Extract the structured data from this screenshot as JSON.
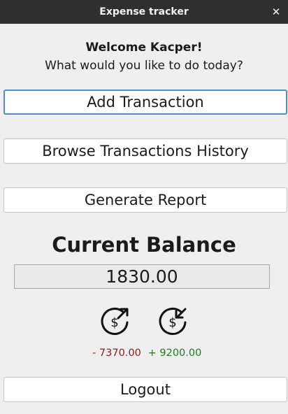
{
  "window": {
    "title": "Expense tracker",
    "close_glyph": "✕"
  },
  "greeting": {
    "welcome": "Welcome Kacper!",
    "prompt": "What would you like to do today?"
  },
  "actions": {
    "add_transaction": "Add Transaction",
    "browse_history": "Browse Transactions History",
    "generate_report": "Generate Report",
    "logout": "Logout"
  },
  "balance": {
    "title": "Current Balance",
    "value": "1830.00",
    "expenses": "- 7370.00",
    "income": "+ 9200.00",
    "expense_icon": "money-out-icon",
    "income_icon": "money-in-icon",
    "expense_color": "#8f1a1a",
    "income_color": "#237a23"
  },
  "colors": {
    "titlebar": "#2f2f2f",
    "background": "#efefef",
    "focus_border": "#4a8fd0"
  }
}
